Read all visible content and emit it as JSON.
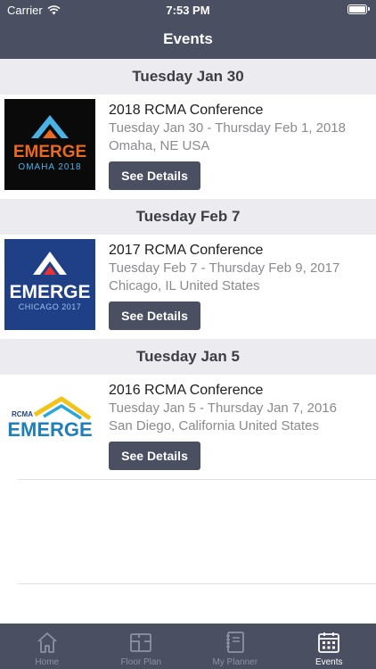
{
  "status_bar": {
    "carrier": "Carrier",
    "time": "7:53 PM"
  },
  "nav": {
    "title": "Events"
  },
  "sections": [
    {
      "header": "Tuesday Jan 30",
      "event": {
        "name": "2018 RCMA Conference",
        "dates": "Tuesday Jan 30 - Thursday Feb 1, 2018",
        "location": "Omaha, NE USA",
        "button": "See Details",
        "logo": {
          "word": "EMERGE",
          "sub": "OMAHA 2018",
          "bg": "#0a0a0a",
          "word_color": "#e8691f",
          "sub_color": "#4ab3e6"
        }
      }
    },
    {
      "header": "Tuesday Feb 7",
      "event": {
        "name": "2017 RCMA Conference",
        "dates": "Tuesday Feb 7 - Thursday Feb 9, 2017",
        "location": "Chicago, IL United States",
        "button": "See Details",
        "logo": {
          "word": "EMERGE",
          "sub": "CHICAGO 2017",
          "bg": "#1f3f86",
          "word_color": "#ffffff",
          "sub_color": "#9fc3ec"
        }
      }
    },
    {
      "header": "Tuesday Jan 5",
      "event": {
        "name": "2016 RCMA Conference",
        "dates": "Tuesday Jan 5 - Thursday Jan 7, 2016",
        "location": "San Diego, California United States",
        "button": "See Details",
        "logo": {
          "word": "EMERGE",
          "sub": "RCMA",
          "bg": "#ffffff",
          "word_color": "#1f7fb8",
          "sub_color": "#1f3f86"
        }
      }
    }
  ],
  "tabs": [
    {
      "label": "Home",
      "icon": "home-icon",
      "active": false
    },
    {
      "label": "Floor Plan",
      "icon": "floor-plan-icon",
      "active": false
    },
    {
      "label": "My Planner",
      "icon": "planner-icon",
      "active": false
    },
    {
      "label": "Events",
      "icon": "calendar-icon",
      "active": true
    }
  ],
  "colors": {
    "bar": "#4a4f61",
    "section_bg": "#ebebf0",
    "button": "#4a4f61"
  }
}
